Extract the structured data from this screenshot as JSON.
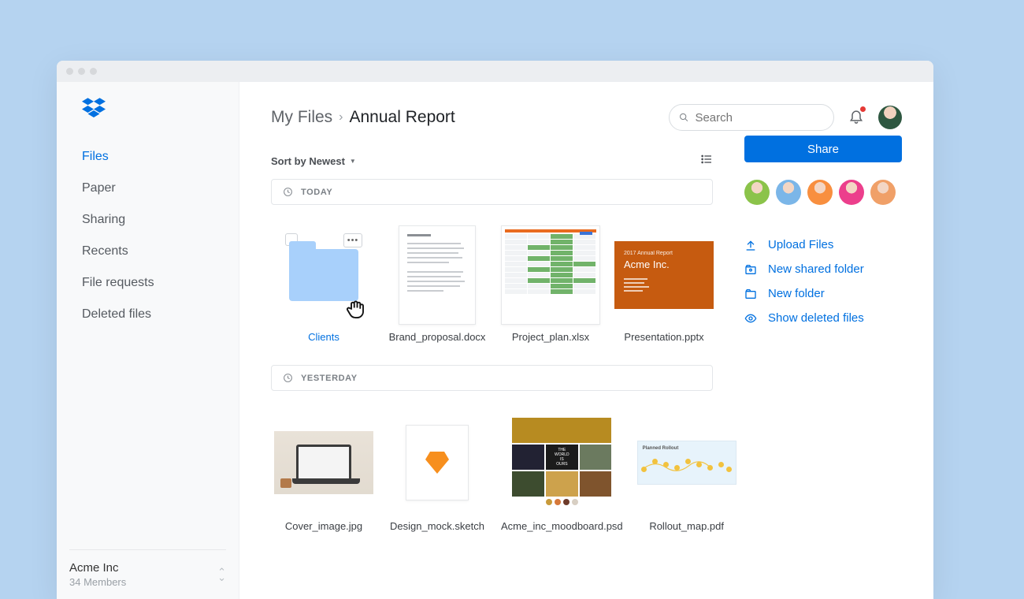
{
  "sidebar": {
    "items": [
      {
        "label": "Files",
        "active": true
      },
      {
        "label": "Paper"
      },
      {
        "label": "Sharing"
      },
      {
        "label": "Recents"
      },
      {
        "label": "File requests"
      },
      {
        "label": "Deleted files"
      }
    ],
    "org": {
      "name": "Acme Inc",
      "members": "34 Members"
    }
  },
  "header": {
    "breadcrumb_root": "My Files",
    "breadcrumb_current": "Annual Report",
    "search_placeholder": "Search"
  },
  "toolbar": {
    "sort_label": "Sort by Newest"
  },
  "right": {
    "share_label": "Share",
    "member_colors": [
      "#8bc34a",
      "#7bb6e8",
      "#f88f3f",
      "#ec3f8c",
      "#f0a068"
    ],
    "actions": [
      {
        "icon": "upload-icon",
        "label": "Upload Files"
      },
      {
        "icon": "shared-folder-icon",
        "label": "New shared folder"
      },
      {
        "icon": "folder-icon",
        "label": "New folder"
      },
      {
        "icon": "eye-icon",
        "label": "Show deleted files"
      }
    ]
  },
  "sections": [
    {
      "label": "TODAY",
      "items": [
        {
          "name": "Clients",
          "type": "folder",
          "link": true
        },
        {
          "name": "Brand_proposal.docx",
          "type": "doc"
        },
        {
          "name": "Project_plan.xlsx",
          "type": "xls"
        },
        {
          "name": "Presentation.pptx",
          "type": "ppt",
          "ppt_sub": "2017 Annual Report",
          "ppt_title": "Acme Inc."
        }
      ]
    },
    {
      "label": "YESTERDAY",
      "items": [
        {
          "name": "Cover_image.jpg",
          "type": "image"
        },
        {
          "name": "Design_mock.sketch",
          "type": "sketch"
        },
        {
          "name": "Acme_inc_moodboard.psd",
          "type": "moodboard"
        },
        {
          "name": "Rollout_map.pdf",
          "type": "rollout",
          "rollout_title": "Planned Rollout"
        }
      ]
    }
  ]
}
